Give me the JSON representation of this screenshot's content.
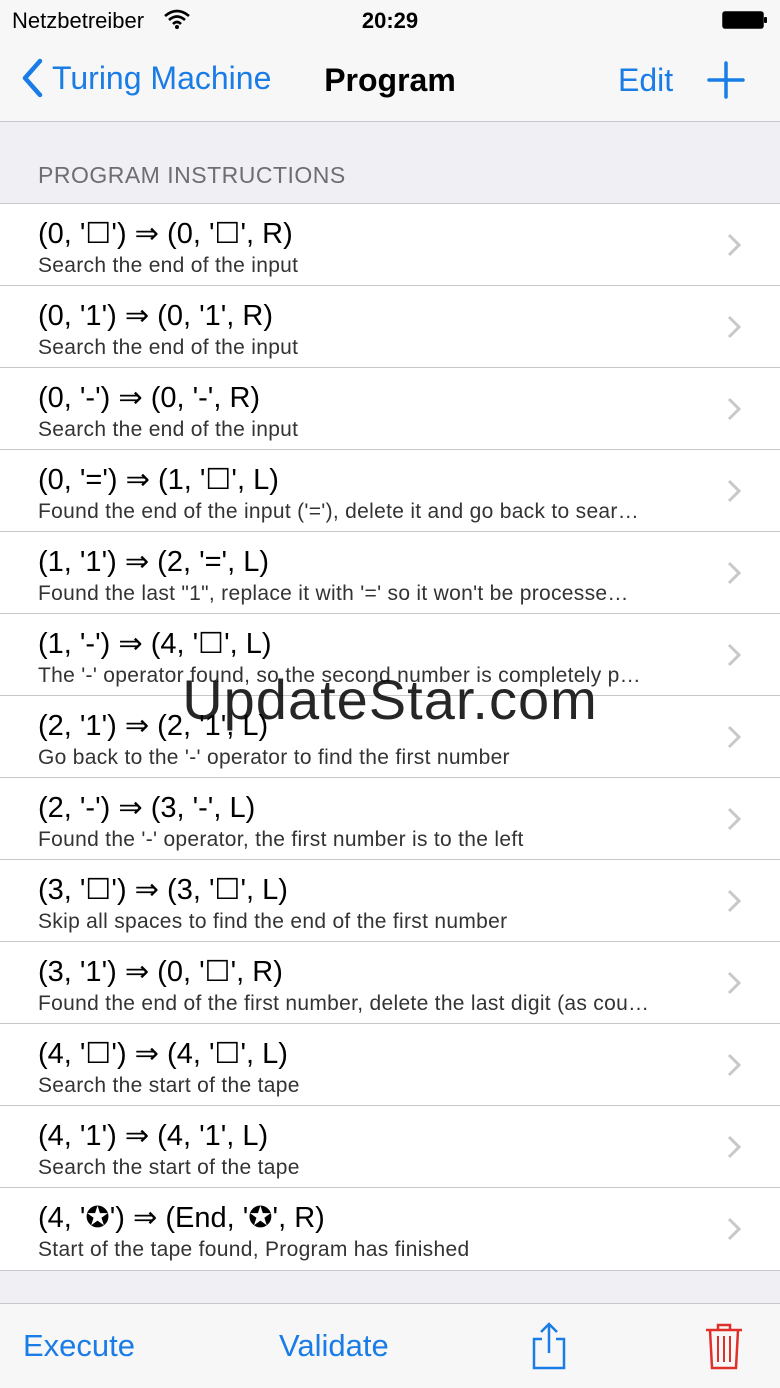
{
  "status_bar": {
    "carrier": "Netzbetreiber",
    "time": "20:29"
  },
  "nav": {
    "back_label": "Turing Machine",
    "title": "Program",
    "edit_label": "Edit"
  },
  "section_header": "PROGRAM INSTRUCTIONS",
  "instructions": [
    {
      "title": "(0, '☐') ⇒ (0, '☐', R)",
      "description": "Search the end of the input"
    },
    {
      "title": "(0, '1') ⇒ (0, '1', R)",
      "description": "Search the end of the input"
    },
    {
      "title": "(0, '-') ⇒ (0, '-', R)",
      "description": "Search the end of the input"
    },
    {
      "title": "(0, '=') ⇒ (1, '☐', L)",
      "description": "Found the end of the input ('='), delete it and go back to sear…"
    },
    {
      "title": "(1, '1') ⇒ (2, '=', L)",
      "description": "Found the last \"1\", replace it with '=' so it won't be processe…"
    },
    {
      "title": "(1, '-') ⇒ (4, '☐', L)",
      "description": "The '-' operator found, so the second number is completely p…"
    },
    {
      "title": "(2, '1') ⇒ (2, '1', L)",
      "description": "Go back to the '-' operator to find the first number"
    },
    {
      "title": "(2, '-') ⇒ (3, '-', L)",
      "description": "Found the '-' operator, the first number is to the left"
    },
    {
      "title": "(3, '☐') ⇒ (3, '☐', L)",
      "description": "Skip all spaces to find the end of the first number"
    },
    {
      "title": "(3, '1') ⇒ (0, '☐', R)",
      "description": "Found the end of the first number, delete the last digit (as cou…"
    },
    {
      "title": "(4, '☐') ⇒ (4, '☐', L)",
      "description": "Search the start of the tape"
    },
    {
      "title": "(4, '1') ⇒ (4, '1', L)",
      "description": "Search the start of the tape"
    },
    {
      "title": "(4, '✪') ⇒ (End, '✪', R)",
      "description": "Start of the tape found, Program has finished"
    }
  ],
  "watermark": "UpdateStar.com",
  "toolbar": {
    "execute_label": "Execute",
    "validate_label": "Validate"
  },
  "colors": {
    "accent": "#1a7ce6",
    "destructive": "#e0302a"
  },
  "icons": [
    "wifi-icon",
    "battery-icon",
    "back-chevron-icon",
    "plus-icon",
    "chevron-right-icon",
    "share-icon",
    "trash-icon"
  ]
}
